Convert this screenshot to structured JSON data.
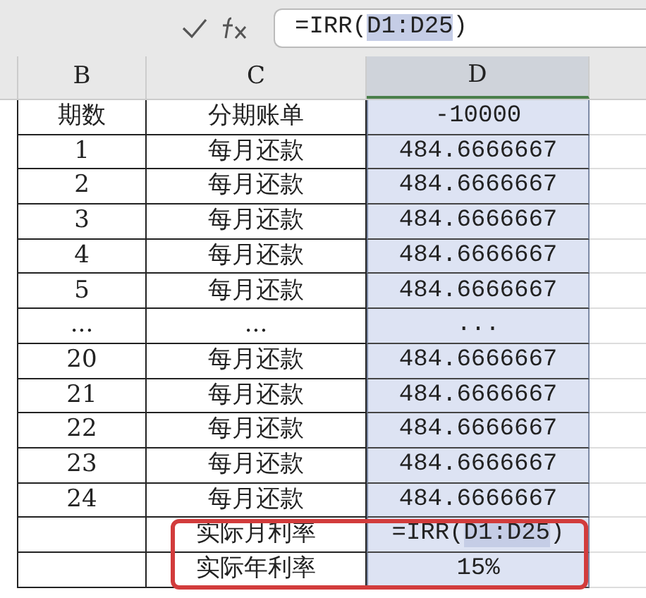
{
  "formula_bar": {
    "formula": {
      "prefix": "=IRR(",
      "reference": "D1:D25",
      "suffix": ")"
    }
  },
  "columns": [
    {
      "label": "B",
      "selected": false
    },
    {
      "label": "C",
      "selected": false
    },
    {
      "label": "D",
      "selected": true
    }
  ],
  "rows": [
    {
      "cells": [
        "期数",
        "分期账单",
        "-10000"
      ],
      "highlighted": false
    },
    {
      "cells": [
        "1",
        "每月还款",
        "484.6666667"
      ],
      "highlighted": false
    },
    {
      "cells": [
        "2",
        "每月还款",
        "484.6666667"
      ],
      "highlighted": false
    },
    {
      "cells": [
        "3",
        "每月还款",
        "484.6666667"
      ],
      "highlighted": false
    },
    {
      "cells": [
        "4",
        "每月还款",
        "484.6666667"
      ],
      "highlighted": false
    },
    {
      "cells": [
        "5",
        "每月还款",
        "484.6666667"
      ],
      "highlighted": false
    },
    {
      "cells": [
        "...",
        "...",
        "..."
      ],
      "highlighted": false
    },
    {
      "cells": [
        "20",
        "每月还款",
        "484.6666667"
      ],
      "highlighted": false
    },
    {
      "cells": [
        "21",
        "每月还款",
        "484.6666667"
      ],
      "highlighted": false
    },
    {
      "cells": [
        "22",
        "每月还款",
        "484.6666667"
      ],
      "highlighted": false
    },
    {
      "cells": [
        "23",
        "每月还款",
        "484.6666667"
      ],
      "highlighted": false
    },
    {
      "cells": [
        "24",
        "每月还款",
        "484.6666667"
      ],
      "highlighted": false
    },
    {
      "cells": [
        "",
        "实际月利率",
        {
          "prefix": "=IRR(",
          "reference": "D1:D25",
          "suffix": ")"
        }
      ],
      "highlighted": true
    },
    {
      "cells": [
        "",
        "实际年利率",
        "15%"
      ],
      "highlighted": true
    }
  ]
}
